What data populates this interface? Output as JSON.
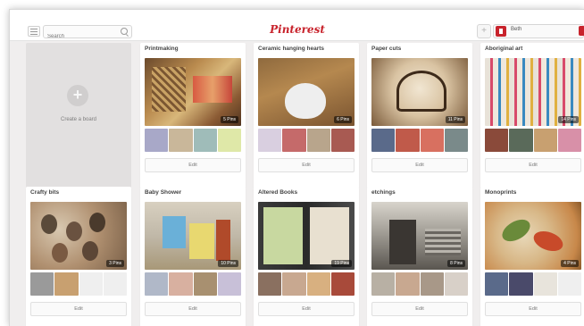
{
  "header": {
    "search_placeholder": "Search",
    "logo": "Pinterest",
    "add_label": "+",
    "user_name": "Beth",
    "brand_color": "#c8232c"
  },
  "create_board": {
    "plus": "+",
    "label": "Create a board"
  },
  "boards": [
    {
      "title": "Printmaking",
      "pins": "5 Pins",
      "edit": "Edit"
    },
    {
      "title": "Ceramic hanging hearts",
      "pins": "6 Pins",
      "edit": "Edit"
    },
    {
      "title": "Paper cuts",
      "pins": "11 Pins",
      "edit": "Edit"
    },
    {
      "title": "Aboriginal art",
      "pins": "14 Pins",
      "edit": "Edit"
    },
    {
      "title": "Crafty bits",
      "pins": "3 Pins",
      "edit": "Edit"
    },
    {
      "title": "Baby Shower",
      "pins": "10 Pins",
      "edit": "Edit"
    },
    {
      "title": "Altered Books",
      "pins": "19 Pins",
      "edit": "Edit"
    },
    {
      "title": "etchings",
      "pins": "8 Pins",
      "edit": "Edit"
    },
    {
      "title": "Monoprints",
      "pins": "4 Pins",
      "edit": "Edit"
    }
  ]
}
